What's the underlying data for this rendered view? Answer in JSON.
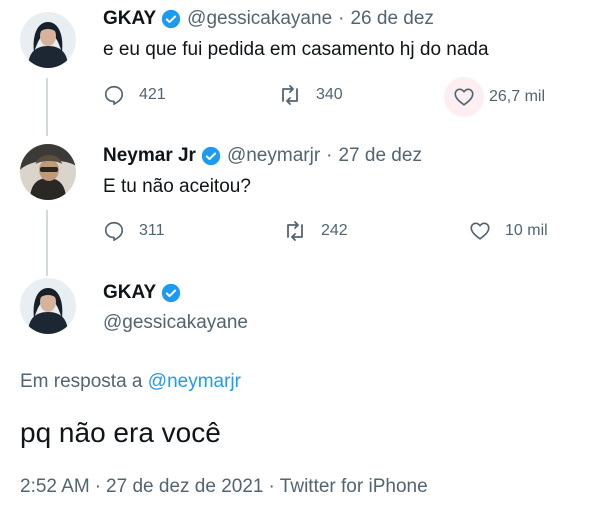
{
  "tweets": [
    {
      "name": "GKAY",
      "handle": "@gessicakayane",
      "date": "26 de dez",
      "text": "e eu que fui pedida em casamento hj do nada",
      "replies": "421",
      "retweets": "340",
      "likes": "26,7 mil"
    },
    {
      "name": "Neymar Jr",
      "handle": "@neymarjr",
      "date": "27 de dez",
      "text": "E tu não aceitou?",
      "replies": "311",
      "retweets": "242",
      "likes": "10 mil"
    }
  ],
  "main": {
    "name": "GKAY",
    "handle": "@gessicakayane",
    "reply_prefix": "Em resposta a",
    "reply_to": "@neymarjr",
    "text": "pq não era você",
    "time": "2:52 AM",
    "date": "27 de dez de 2021",
    "source": "Twitter for iPhone",
    "separator": "·"
  },
  "colors": {
    "accent": "#1d9bf0",
    "muted": "#536471",
    "thread_line": "#cfd9de",
    "hover_bg": "#fdeef2"
  }
}
